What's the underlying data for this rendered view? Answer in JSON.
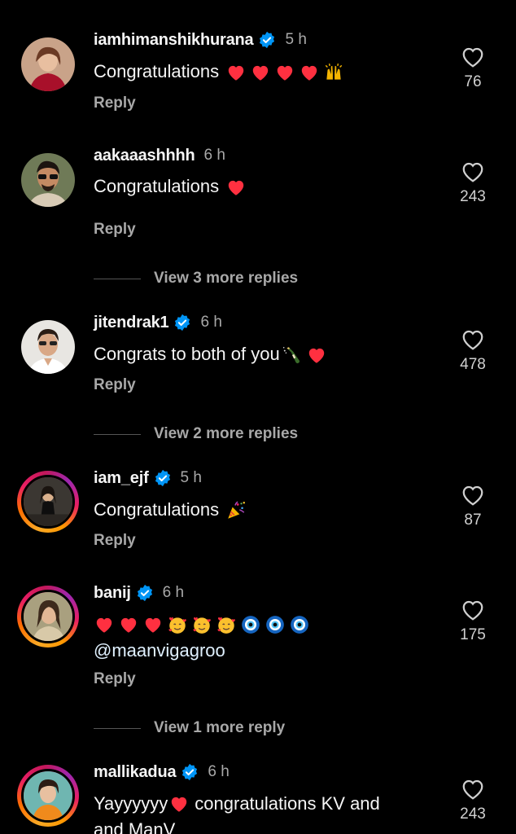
{
  "colors": {
    "background": "#000000",
    "primary_text": "#f5f5f5",
    "secondary_text": "#a8a8a8",
    "verified_blue": "#0095f6",
    "heart_red": "#ff3040"
  },
  "comments": [
    {
      "username": "iamhimanshikhurana",
      "verified": true,
      "time": "5 h",
      "text": "Congratulations",
      "emojis": [
        "red-heart",
        "red-heart",
        "red-heart",
        "red-heart",
        "raising-hands"
      ],
      "reply_label": "Reply",
      "likes": "76"
    },
    {
      "username": "aakaaashhhh",
      "verified": false,
      "time": "6 h",
      "text": "Congratulations",
      "emojis": [
        "red-heart"
      ],
      "reply_label": "Reply",
      "likes": "243",
      "view_more": "View 3 more replies"
    },
    {
      "username": "jitendrak1",
      "verified": true,
      "time": "6 h",
      "text": "Congrats to both of you",
      "emojis": [
        "champagne",
        "red-heart"
      ],
      "reply_label": "Reply",
      "likes": "478",
      "view_more": "View 2 more replies"
    },
    {
      "username": "iam_ejf",
      "verified": true,
      "time": "5 h",
      "text": "Congratulations",
      "emojis": [
        "party-popper"
      ],
      "reply_label": "Reply",
      "likes": "87"
    },
    {
      "username": "banij",
      "verified": true,
      "time": "6 h",
      "emojis": [
        "red-heart",
        "red-heart",
        "red-heart",
        "smiling-hearts",
        "smiling-hearts",
        "smiling-hearts",
        "nazar",
        "nazar",
        "nazar"
      ],
      "mention": "@maanvigagroo",
      "reply_label": "Reply",
      "likes": "175",
      "view_more": "View 1 more reply"
    },
    {
      "username": "mallikadua",
      "verified": true,
      "time": "6 h",
      "text_part1": "Yayyyyyy",
      "text_part2": "congratulations KV and",
      "text_line2": "and ManV",
      "emojis": [
        "red-heart"
      ],
      "likes": "243"
    }
  ]
}
